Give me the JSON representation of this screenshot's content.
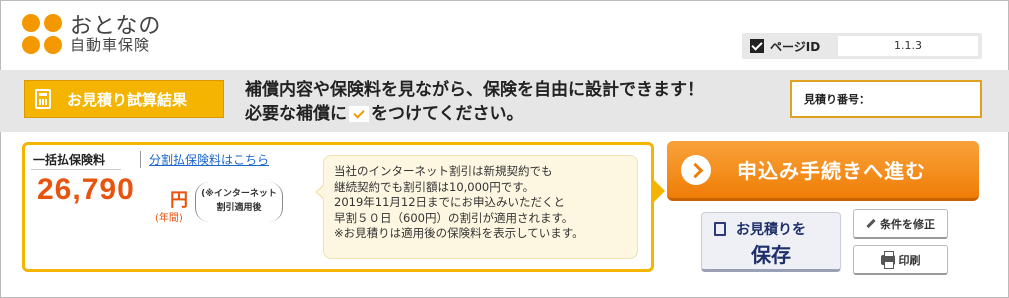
{
  "logo": {
    "main": "おとなの",
    "sub": "自動車保険"
  },
  "page_id": {
    "label": "ページID",
    "value": "1.1.3"
  },
  "band": {
    "result_tab_label": "お見積り試算結果",
    "message_line1": "補償内容や保険料を見ながら、保険を自由に設計できます！",
    "message_line2_prefix": "必要な補償に",
    "message_line2_suffix": "をつけてください。",
    "quote_number_label": "見積り番号："
  },
  "premium": {
    "tab_lump": "一括払保険料",
    "tab_split": "分割払保険料はこちら",
    "amount": "26,790",
    "unit": "円",
    "period": "(年間)",
    "discount_note_line1": "(※インターネット",
    "discount_note_line2": "割引適用後",
    "notice_lines": [
      "当社のインターネット割引は新規契約でも",
      "継続契約でも割引額は10,000円です。",
      "2019年11月12日までにお申込みいただくと",
      "早割５０日（600円）の割引が適用されます。",
      "※お見積りは適用後の保険料を表示しています。"
    ]
  },
  "actions": {
    "apply_label": "申込み手続きへ進む",
    "save_line1": "お見積りを",
    "save_line2": "保存",
    "edit_label": "条件を修正",
    "print_label": "印刷"
  },
  "colors": {
    "accent_orange": "#f39800",
    "price_red": "#e8530e",
    "tab_yellow": "#f4b400",
    "link_blue": "#1a66cc"
  }
}
